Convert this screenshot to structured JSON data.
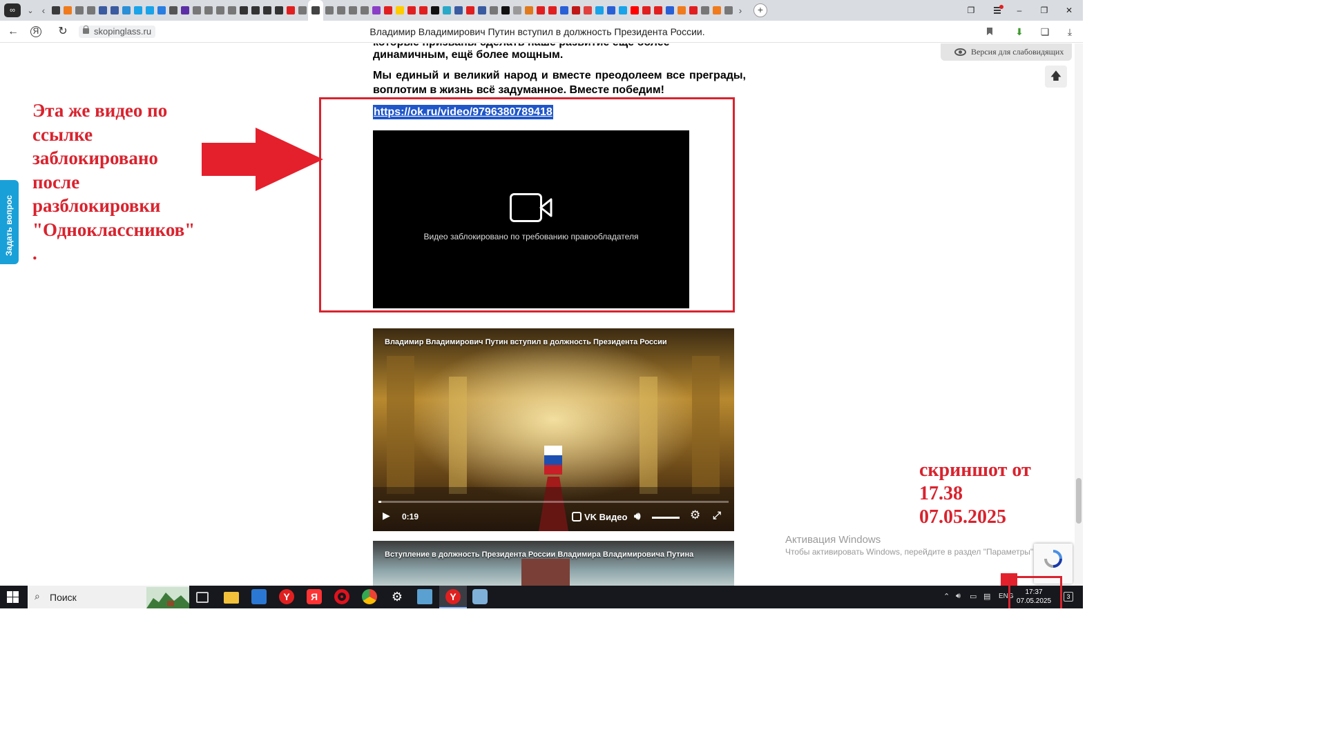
{
  "browser": {
    "url": "skopinglass.ru",
    "page_title": "Владимир Владимирович Путин вступил в должность Президента России.",
    "tab_fav_colors": [
      "#3b3b3b",
      "#f07b1d",
      "#777",
      "#777",
      "#3a5ba0",
      "#3a5ba0",
      "#2a8fd6",
      "#1aa3e8",
      "#1aa3e8",
      "#2a7de1",
      "#555",
      "#5b2ea6",
      "#777",
      "#777",
      "#777",
      "#777",
      "#333",
      "#333",
      "#333",
      "#333",
      "#e02020",
      "#777",
      "#777",
      "#777",
      "#777",
      "#777",
      "#8a3fc6",
      "#e02020",
      "#ffcc00",
      "#e02020",
      "#e02020",
      "#111",
      "#2aa8c8",
      "#3a5ba0",
      "#e02020",
      "#3a5ba0",
      "#777",
      "#111",
      "#999",
      "#e07a1d",
      "#e02020",
      "#e02020",
      "#2a60d6",
      "#c01818",
      "#e04040",
      "#1aa3e8",
      "#2a60d6",
      "#1aa3e8",
      "#ff0000",
      "#e02020",
      "#e02020",
      "#2a60d6",
      "#f07b1d",
      "#e02020",
      "#777",
      "#f07b1d",
      "#777"
    ]
  },
  "article": {
    "line0": "которые призваны сделать наше развитие ещё более",
    "line1": "динамичным, ещё более мощным.",
    "para2": "Мы единый и великий народ и вместе преодолеем все преграды, воплотим в жизнь всё задуманное. Вместе победим!",
    "video_link": "https://ok.ru/video/9796380789418"
  },
  "blocked_player": {
    "message": "Видео заблокировано по требованию правообладателя"
  },
  "vk_player": {
    "title": "Владимир Владимирович Путин вступил в должность Президента России",
    "time": "0:19",
    "brand": "VK Видео"
  },
  "vk_player2": {
    "title": "Вступление в должность Президента России Владимира Владимировича Путина"
  },
  "side_tab": {
    "label": "Задать вопрос"
  },
  "accessibility": {
    "label": "Версия для слабовидящих"
  },
  "annotations": {
    "left_note": "Эта же видео по ссылке заблокировано после разблокировки \"Одноклассников\" .",
    "right_note_line1": "скриншот от",
    "right_note_line2": "17.38",
    "right_note_line3": "07.05.2025",
    "color": "#d9232e"
  },
  "windows_activation": {
    "title": "Активация Windows",
    "subtitle": "Чтобы активировать Windows, перейдите в раздел \"Параметры\"."
  },
  "taskbar": {
    "search_label": "Поиск",
    "lang": "ENG",
    "time": "17:37",
    "date": "07.05.2025",
    "notifications": "3"
  }
}
